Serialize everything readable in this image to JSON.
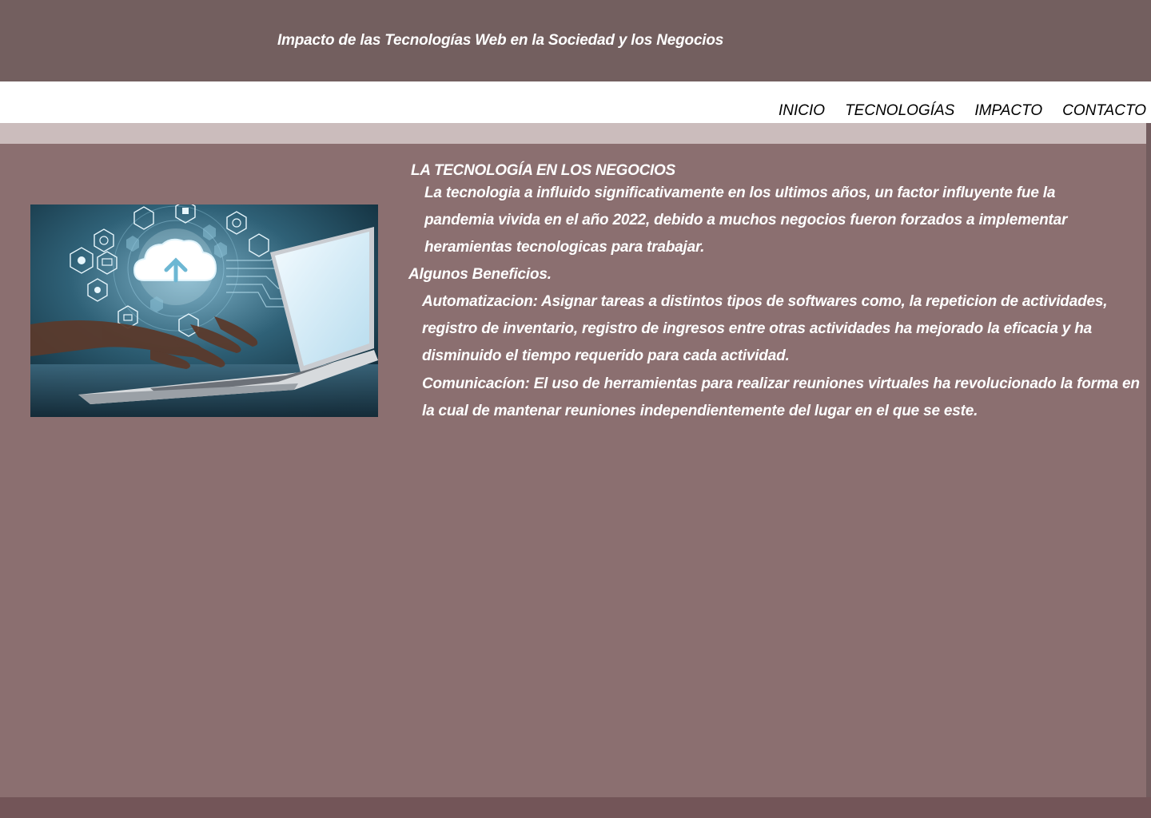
{
  "header": {
    "title": "Impacto de las Tecnologías Web en  la Sociedad y los Negocios"
  },
  "nav": {
    "items": [
      {
        "label": "INICIO"
      },
      {
        "label": "TECNOLOGÍAS"
      },
      {
        "label": "IMPACTO"
      },
      {
        "label": "CONTACTO"
      }
    ]
  },
  "content": {
    "heading": "LA TECNOLOGÍA EN LOS NEGOCIOS",
    "intro": "La tecnologia a influido significativamente en los ultimos años, un factor influyente fue la pandemia vivida en el año 2022, debido a muchos negocios fueron forzados a implementar heramientas tecnologicas para trabajar.",
    "benefits_heading": "Algunos Beneficios.",
    "benefit_automation": "Automatizacion: Asignar tareas a distintos tipos de softwares como, la repeticion de actividades, registro de inventario,  registro de ingresos entre otras actividades ha mejorado la eficacia y ha disminuido el tiempo requerido para cada actividad.",
    "benefit_communication": "Comunicacíon: El uso de herramientas para realizar reuniones virtuales ha revolucionado la forma en la cual de mantenar reuniones independientemente del lugar en el que se este."
  },
  "image": {
    "subject": "laptop with cloud upload technology icons",
    "icons": [
      "cloud-upload-icon",
      "globe-icon",
      "envelope-icon",
      "download-icon",
      "network-icon"
    ]
  },
  "colors": {
    "header_bg": "#735f5f",
    "nav_bg": "#ffffff",
    "stripe_bg": "#cbbcbc",
    "main_bg": "#8b6f70",
    "footer_bg": "#735558",
    "text_light": "#ffffff",
    "text_dark": "#000000"
  }
}
